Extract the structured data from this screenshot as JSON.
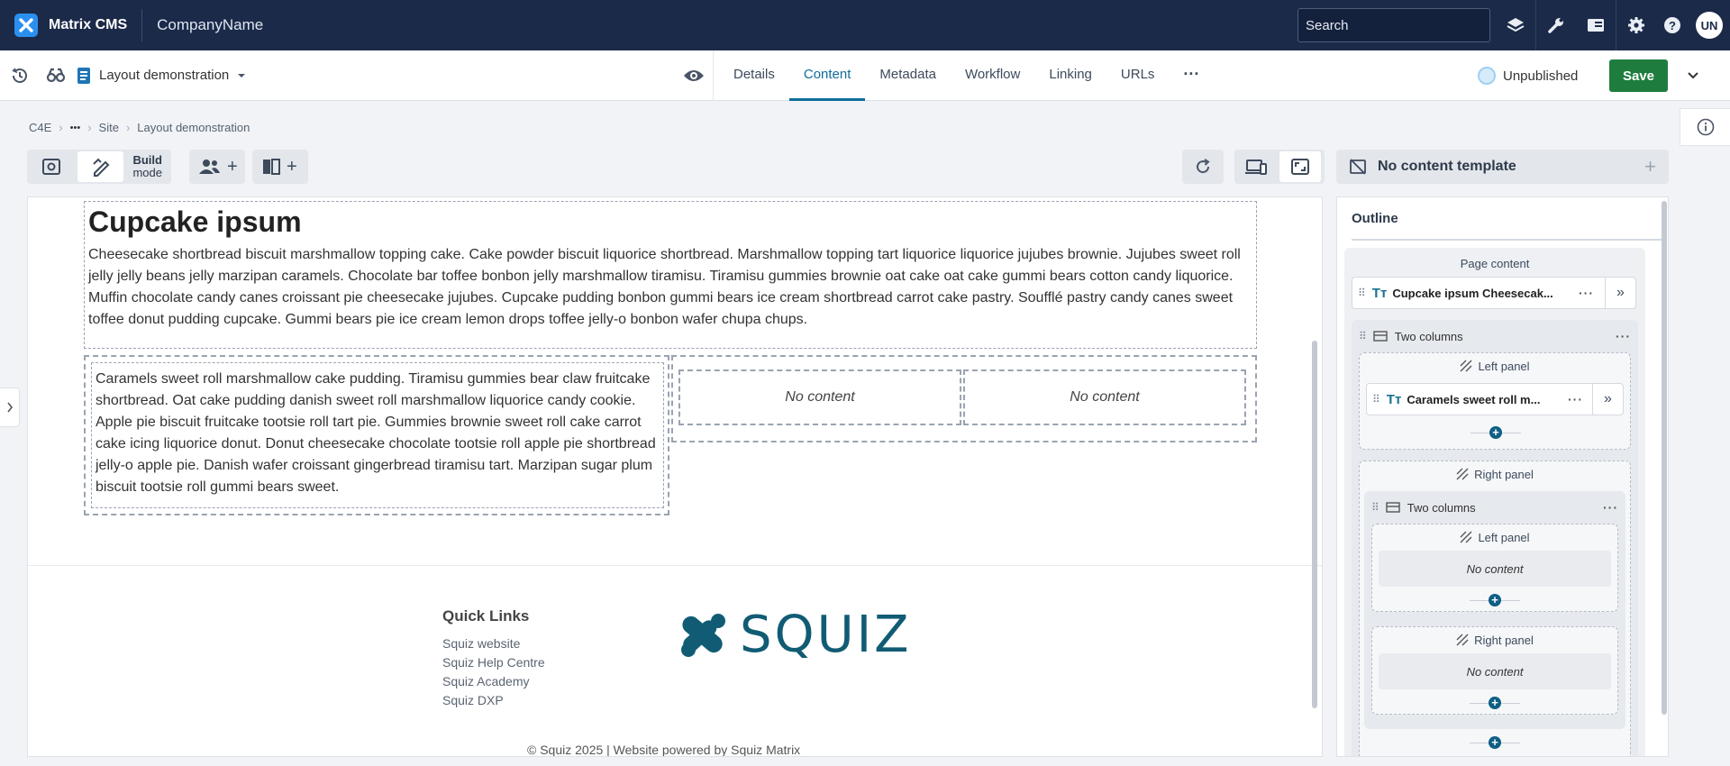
{
  "topbar": {
    "app_name": "Matrix CMS",
    "company": "CompanyName",
    "search_placeholder": "Search",
    "user_initials": "UN"
  },
  "toolbar2": {
    "asset_name": "Layout demonstration",
    "tabs": [
      "Details",
      "Content",
      "Metadata",
      "Workflow",
      "Linking",
      "URLs"
    ],
    "active_tab": "Content",
    "more_label": "···",
    "status": "Unpublished",
    "save_label": "Save"
  },
  "breadcrumb": [
    "C4E",
    "•••",
    "Site",
    "Layout demonstration"
  ],
  "canvas_toolbar": {
    "build_mode_label_1": "Build",
    "build_mode_label_2": "mode",
    "content_template": "No content template"
  },
  "canvas": {
    "heading": "Cupcake ipsum",
    "paragraph_1": "Cheesecake shortbread biscuit marshmallow topping cake. Cake powder biscuit liquorice shortbread. Marshmallow topping tart liquorice liquorice jujubes brownie. Jujubes sweet roll jelly jelly beans jelly marzipan caramels. Chocolate bar toffee bonbon jelly marshmallow tiramisu. Tiramisu gummies brownie oat cake oat cake gummi bears cotton candy liquorice. Muffin chocolate candy canes croissant pie cheesecake jujubes. Cupcake pudding bonbon gummi bears ice cream shortbread carrot cake pastry. Soufflé pastry candy canes sweet toffee donut pudding cupcake. Gummi bears pie ice cream lemon drops toffee jelly-o bonbon wafer chupa chups.",
    "paragraph_2": "Caramels sweet roll marshmallow cake pudding. Tiramisu gummies bear claw fruitcake shortbread. Oat cake pudding danish sweet roll marshmallow liquorice candy cookie. Apple pie biscuit fruitcake tootsie roll tart pie. Gummies brownie sweet roll cake carrot cake icing liquorice donut. Donut cheesecake chocolate tootsie roll apple pie shortbread jelly-o apple pie. Danish wafer croissant gingerbread tiramisu tart. Marzipan sugar plum biscuit tootsie roll gummi bears sweet.",
    "no_content": "No content",
    "footer": {
      "quick_links_title": "Quick Links",
      "links": [
        "Squiz website",
        "Squiz Help Centre",
        "Squiz Academy",
        "Squiz DXP"
      ],
      "logo_text": "SQUIZ",
      "copyright": "© Squiz 2025 | Website powered by Squiz Matrix"
    }
  },
  "outline": {
    "title": "Outline",
    "page_content": "Page content",
    "item_1": "Cupcake ipsum Cheesecak...",
    "two_columns": "Two columns",
    "left_panel": "Left panel",
    "right_panel": "Right panel",
    "item_2": "Caramels sweet roll m...",
    "no_content": "No content"
  },
  "colors": {
    "topbar": "#1b2a49",
    "accent": "#0f6e9b",
    "save": "#1e7d3e",
    "logo": "#115c74"
  }
}
